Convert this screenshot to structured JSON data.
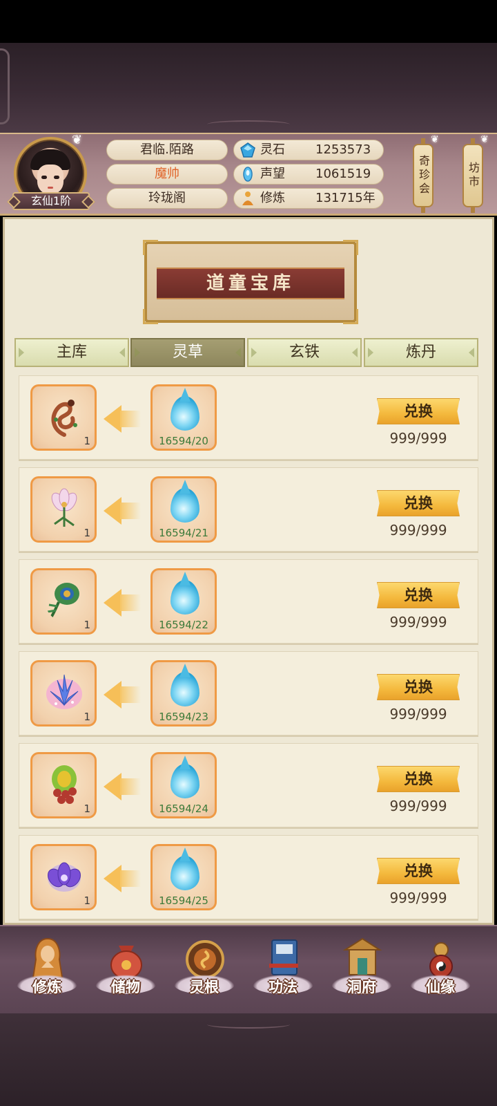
{
  "player": {
    "rank": "玄仙1阶",
    "name": "君临.陌路",
    "title": "魔帅",
    "sect": "玲珑阁"
  },
  "resources": [
    {
      "icon": "spirit-stone-icon",
      "label": "灵石",
      "value": "1253573"
    },
    {
      "icon": "reputation-icon",
      "label": "声望",
      "value": "1061519"
    },
    {
      "icon": "cultivation-icon",
      "label": "修炼",
      "value": "131715年"
    }
  ],
  "side_buttons": {
    "treasure_fair": "奇珍会",
    "market": "坊市"
  },
  "panel": {
    "title": "道童宝库",
    "tabs": [
      {
        "label": "主库",
        "active": false
      },
      {
        "label": "灵草",
        "active": true
      },
      {
        "label": "玄铁",
        "active": false
      },
      {
        "label": "炼丹",
        "active": false
      }
    ]
  },
  "exchange_label": "兑换",
  "items": [
    {
      "icon": "dragon-herb-icon",
      "count": "1",
      "cost": "16594/20",
      "stock": "999/999",
      "color": "#a5512f"
    },
    {
      "icon": "lily-flower-icon",
      "count": "1",
      "cost": "16594/21",
      "stock": "999/999",
      "color": "#e8b6d8"
    },
    {
      "icon": "peacock-feather-herb-icon",
      "count": "1",
      "cost": "16594/22",
      "stock": "999/999",
      "color": "#3f8a4a"
    },
    {
      "icon": "crystal-flower-icon",
      "count": "1",
      "cost": "16594/23",
      "stock": "999/999",
      "color": "#5b7fe6"
    },
    {
      "icon": "berry-cluster-icon",
      "count": "1",
      "cost": "16594/24",
      "stock": "999/999",
      "color": "#b33a2f"
    },
    {
      "icon": "purple-lotus-icon",
      "count": "1",
      "cost": "16594/25",
      "stock": "999/999",
      "color": "#7a4fd6"
    }
  ],
  "nav": [
    {
      "label": "修炼",
      "icon": "monk-icon",
      "color": "#d48a3a"
    },
    {
      "label": "储物",
      "icon": "bag-icon",
      "color": "#d2543f"
    },
    {
      "label": "灵根",
      "icon": "spirit-root-icon",
      "color": "#c06a2a"
    },
    {
      "label": "功法",
      "icon": "book-icon",
      "color": "#3d6aa6"
    },
    {
      "label": "洞府",
      "icon": "palace-icon",
      "color": "#c0883a"
    },
    {
      "label": "仙缘",
      "icon": "gourd-icon",
      "color": "#b23a2a"
    }
  ]
}
